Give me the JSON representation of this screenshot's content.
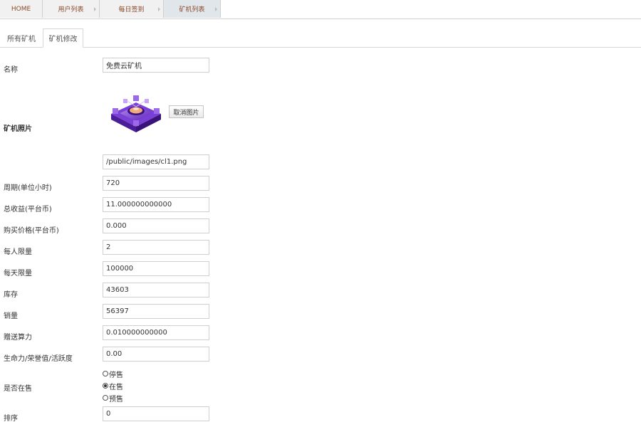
{
  "top_nav": {
    "tabs": [
      {
        "label": "HOME"
      },
      {
        "label": "用户列表"
      },
      {
        "label": "每日签到"
      },
      {
        "label": "矿机列表"
      }
    ]
  },
  "sub_tabs": {
    "all_miners": "所有矿机",
    "edit_miner": "矿机修改"
  },
  "form": {
    "name": {
      "label": "名称",
      "value": "免费云矿机"
    },
    "photo": {
      "label": "矿机照片",
      "cancel_button": "取消图片",
      "path": "/public/images/cl1.png"
    },
    "period": {
      "label": "周期(单位小时)",
      "value": "720"
    },
    "total_income": {
      "label": "总收益(平台币)",
      "value": "11.000000000000"
    },
    "price": {
      "label": "购买价格(平台币)",
      "value": "0.000"
    },
    "per_person_limit": {
      "label": "每人限量",
      "value": "2"
    },
    "daily_limit": {
      "label": "每天限量",
      "value": "100000"
    },
    "stock": {
      "label": "库存",
      "value": "43603"
    },
    "sales": {
      "label": "销量",
      "value": "56397"
    },
    "bonus_power": {
      "label": "赠送算力",
      "value": "0.010000000000"
    },
    "vitality": {
      "label": "生命力/荣誉值/活跃度",
      "value": "0.00"
    },
    "on_sale": {
      "label": "是否在售",
      "options": [
        {
          "label": "停售",
          "checked": false
        },
        {
          "label": "在售",
          "checked": true
        },
        {
          "label": "预售",
          "checked": false
        }
      ]
    },
    "sort": {
      "label": "排序",
      "value": "0"
    }
  }
}
